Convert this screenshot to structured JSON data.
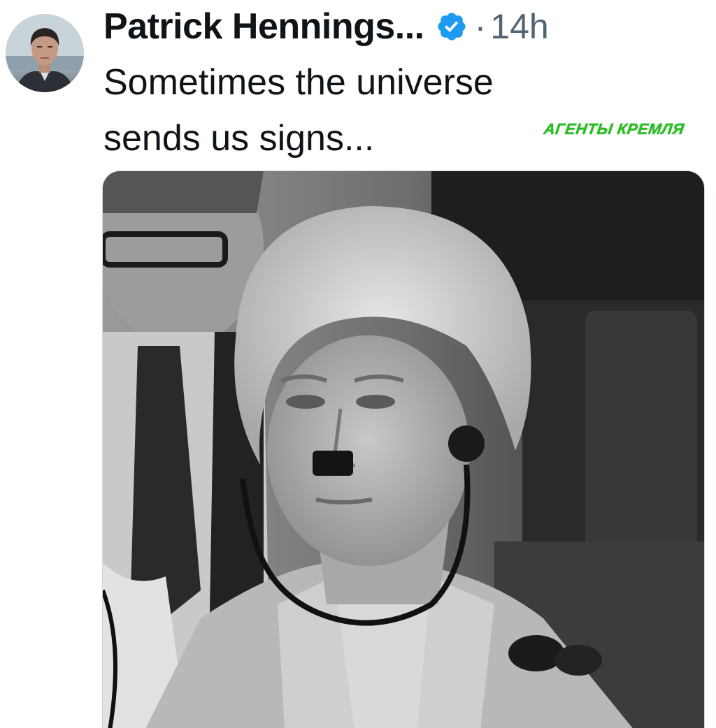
{
  "tweet": {
    "author": {
      "display_name": "Patrick Hennings...",
      "verified": true,
      "verified_icon": "verified-badge-icon",
      "avatar_icon": "profile-photo"
    },
    "separator": "·",
    "timestamp": "14h",
    "text": "Sometimes the universe\nsends us signs...",
    "media_description_icon": "photo-grayscale-woman-with-headset",
    "watermark": "АГЕНТЫ КРЕМЛЯ"
  },
  "colors": {
    "text_primary": "#0f1419",
    "text_secondary": "#536471",
    "verified_blue": "#1d9bf0",
    "watermark_green": "#22c31a"
  }
}
